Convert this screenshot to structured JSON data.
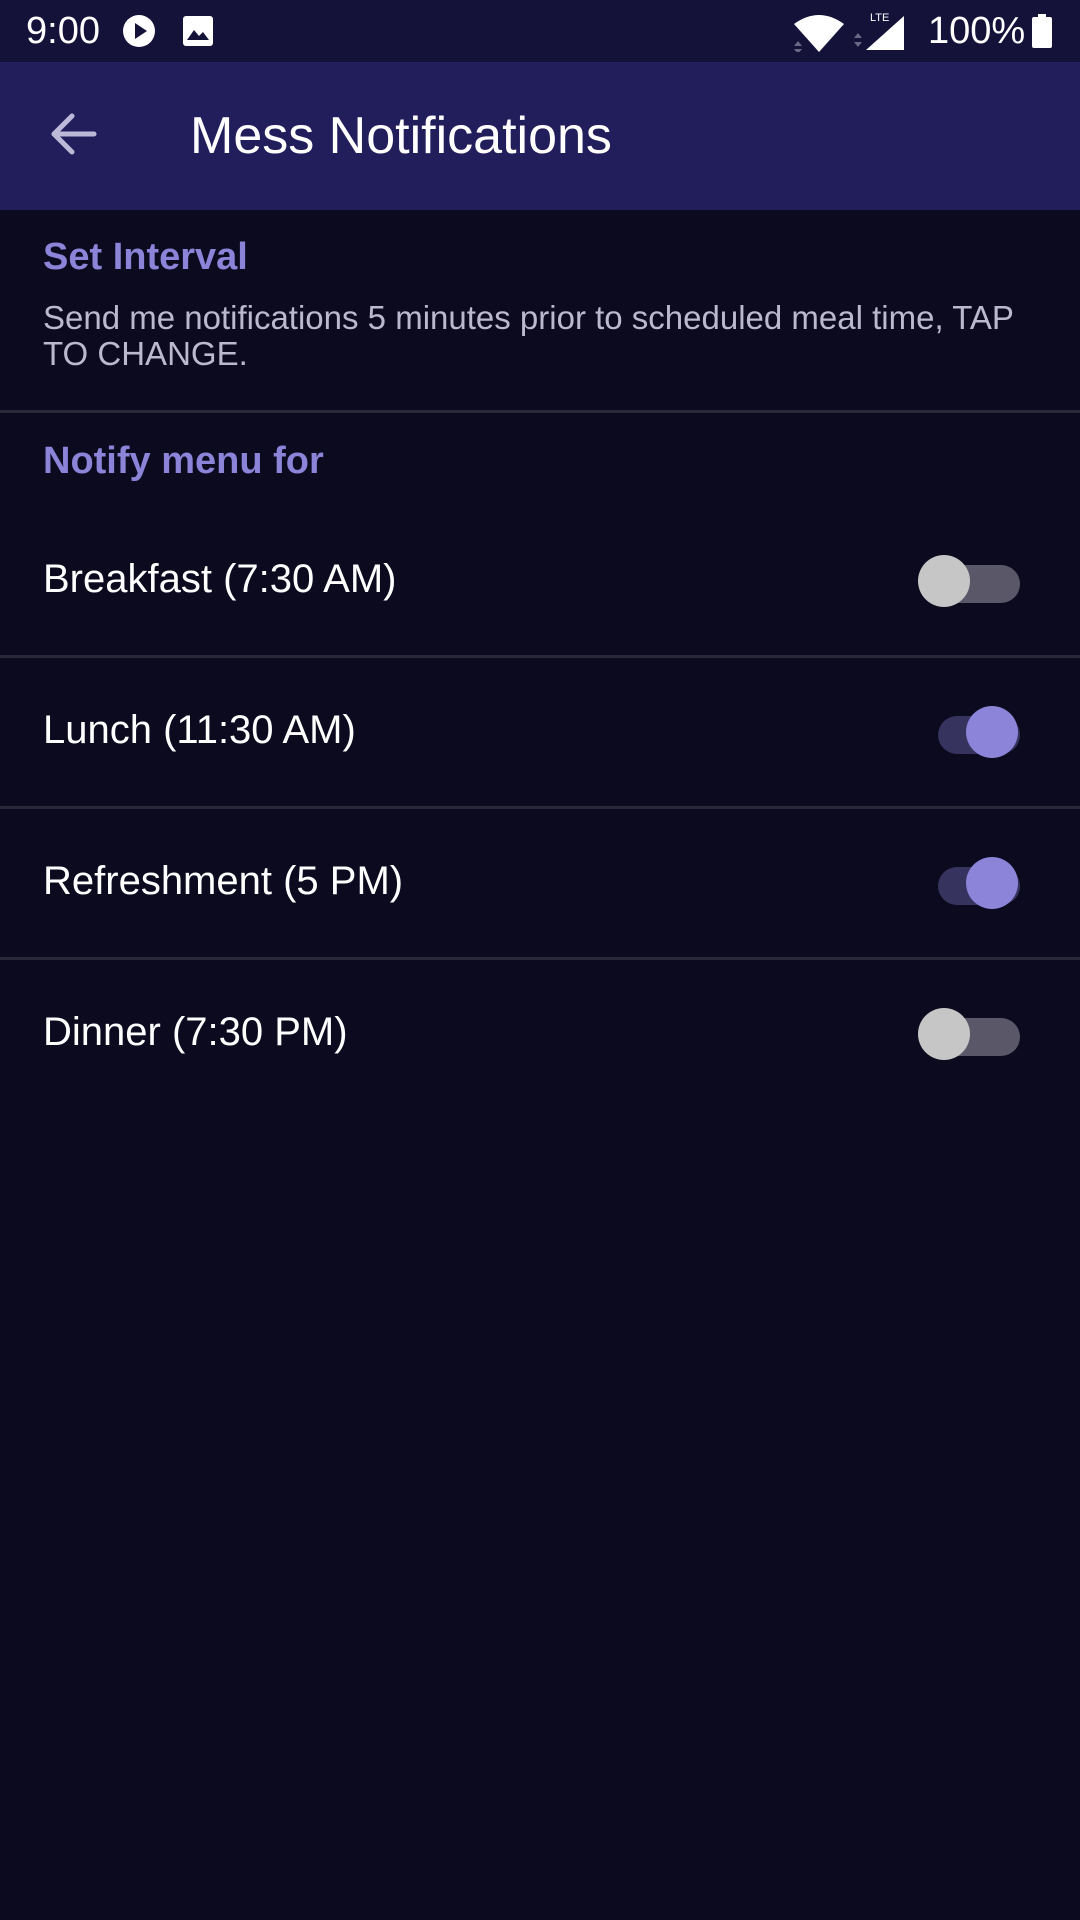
{
  "status_bar": {
    "time": "9:00",
    "battery": "100%",
    "icons": [
      "play-icon",
      "image-icon",
      "wifi-icon",
      "lte-signal-icon",
      "battery-icon"
    ],
    "network_label": "LTE"
  },
  "app_bar": {
    "title": "Mess Notifications",
    "back_icon": "arrow-back-icon"
  },
  "interval": {
    "title": "Set Interval",
    "summary": "Send me notifications 5 minutes prior to scheduled meal time, TAP TO CHANGE."
  },
  "notify": {
    "title": "Notify menu for",
    "items": [
      {
        "label": "Breakfast (7:30 AM)",
        "enabled": false
      },
      {
        "label": "Lunch (11:30 AM)",
        "enabled": true
      },
      {
        "label": "Refreshment (5 PM)",
        "enabled": true
      },
      {
        "label": "Dinner (7:30 PM)",
        "enabled": false
      }
    ]
  },
  "colors": {
    "background": "#0c0a1f",
    "app_bar": "#221e5c",
    "accent": "#8b84d8"
  }
}
